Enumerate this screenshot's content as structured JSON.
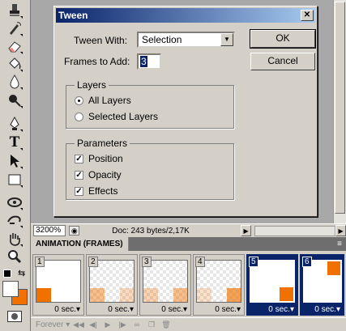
{
  "dialog": {
    "title": "Tween",
    "close_symbol": "✕",
    "tween_with_label": "Tween With:",
    "tween_with_value": "Selection",
    "frames_label": "Frames to Add:",
    "frames_value": "3",
    "ok_label": "OK",
    "cancel_label": "Cancel",
    "layers": {
      "legend": "Layers",
      "options": [
        {
          "label": "All Layers",
          "selected": true
        },
        {
          "label": "Selected Layers",
          "selected": false
        }
      ]
    },
    "parameters": {
      "legend": "Parameters",
      "options": [
        {
          "label": "Position",
          "checked": true
        },
        {
          "label": "Opacity",
          "checked": true
        },
        {
          "label": "Effects",
          "checked": true
        }
      ]
    }
  },
  "status": {
    "zoom": "3200%",
    "doc_info": "Doc: 243 bytes/2,17K"
  },
  "animation": {
    "tab_title": "ANIMATION (FRAMES)",
    "menu_icon": "≡",
    "frames": [
      {
        "number": "1",
        "delay": "0 sec.",
        "selected": false
      },
      {
        "number": "2",
        "delay": "0 sec.",
        "selected": false
      },
      {
        "number": "3",
        "delay": "0 sec.",
        "selected": false
      },
      {
        "number": "4",
        "delay": "0 sec.",
        "selected": false
      },
      {
        "number": "5",
        "delay": "0 sec.",
        "selected": true
      },
      {
        "number": "6",
        "delay": "0 sec.",
        "selected": true
      }
    ],
    "loop": "Forever",
    "accent_color": "#f07000",
    "selection_color": "#0a246a"
  },
  "tools": [
    "stamp-icon",
    "history-brush-icon",
    "eraser-icon",
    "paint-bucket-icon",
    "blur-icon",
    "dodge-icon",
    "pen-icon",
    "type-icon",
    "path-select-icon",
    "rectangle-icon",
    "note-icon",
    "eyedropper-icon",
    "hand-icon",
    "zoom-icon"
  ],
  "colors": {
    "foreground": "#ffffff",
    "background": "#f07000"
  }
}
